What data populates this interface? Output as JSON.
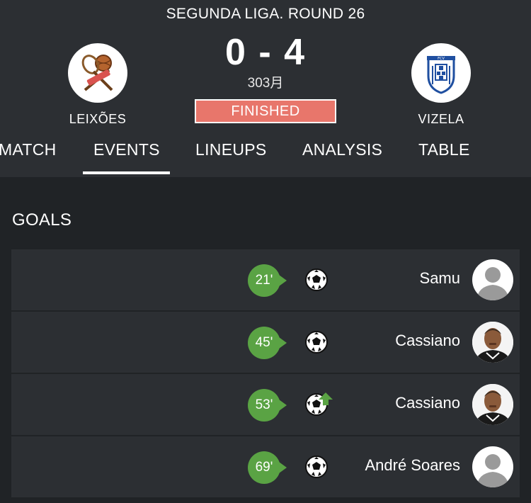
{
  "header": {
    "league": "SEGUNDA LIGA. ROUND 26",
    "score": "0 - 4",
    "date": "303月",
    "status": "FINISHED",
    "home_team": "LEIXÕES",
    "away_team": "VIZELA"
  },
  "tabs": [
    {
      "label": "MATCH"
    },
    {
      "label": "EVENTS",
      "active": true
    },
    {
      "label": "LINEUPS"
    },
    {
      "label": "ANALYSIS"
    },
    {
      "label": "TABLE"
    }
  ],
  "goals_section": {
    "title": "GOALS",
    "items": [
      {
        "minute": "21'",
        "player": "Samu",
        "avatar": "placeholder",
        "icon": "ball-icon"
      },
      {
        "minute": "45'",
        "player": "Cassiano",
        "avatar": "photo",
        "icon": "ball-icon"
      },
      {
        "minute": "53'",
        "player": "Cassiano",
        "avatar": "photo",
        "icon": "ball-assist-icon"
      },
      {
        "minute": "69'",
        "player": "André Soares",
        "avatar": "placeholder",
        "icon": "ball-icon"
      }
    ]
  },
  "colors": {
    "background": "#202326",
    "header": "#2c2f33",
    "row": "#2c2f33",
    "status_badge": "#e8766b",
    "minute_badge": "#5aa344"
  }
}
